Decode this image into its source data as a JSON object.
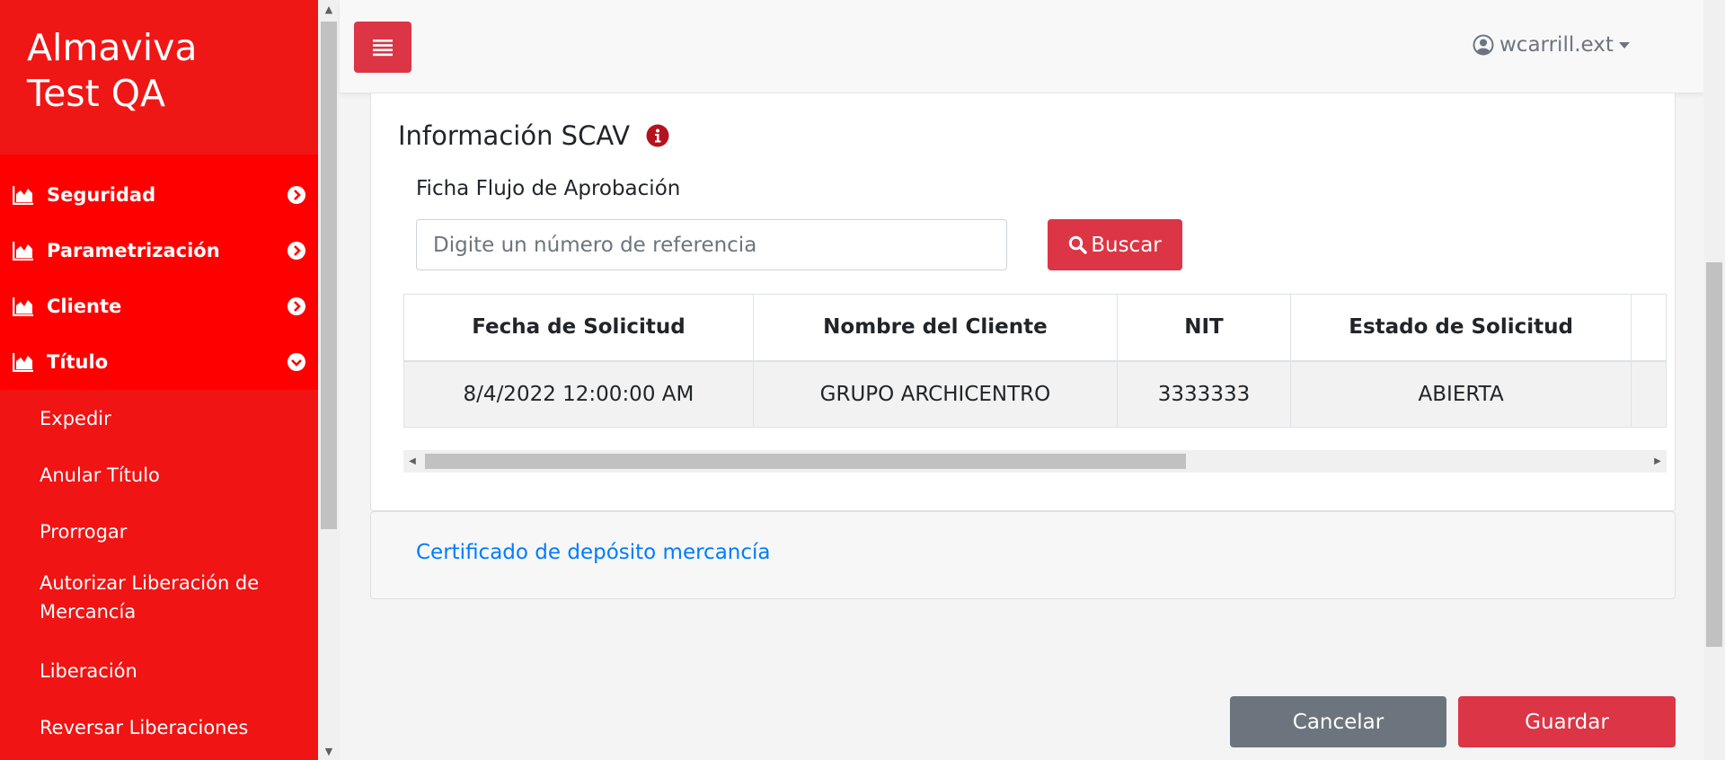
{
  "brand": {
    "line1": "Almaviva",
    "line2": "Test QA"
  },
  "sidebar": {
    "menu": [
      {
        "label": "Seguridad",
        "icon": "chart-area-icon",
        "state": "collapsed"
      },
      {
        "label": "Parametrización",
        "icon": "chart-area-icon",
        "state": "collapsed"
      },
      {
        "label": "Cliente",
        "icon": "chart-area-icon",
        "state": "collapsed"
      },
      {
        "label": "Título",
        "icon": "chart-area-icon",
        "state": "expanded"
      }
    ],
    "submenu": [
      "Expedir",
      "Anular Título",
      "Prorrogar",
      "Autorizar Liberación de Mercancía",
      "Liberación",
      "Reversar Liberaciones"
    ]
  },
  "topbar": {
    "menu_toggle_icon": "hamburger-icon",
    "username": "wcarrill.ext"
  },
  "section": {
    "title": "Información SCAV",
    "field_label": "Ficha Flujo de Aprobación",
    "search_placeholder": "Digite un número de referencia",
    "search_value": "",
    "search_button": "Buscar"
  },
  "table": {
    "headers": [
      "Fecha de Solicitud",
      "Nombre del Cliente",
      "NIT",
      "Estado de Solicitud",
      ""
    ],
    "rows": [
      [
        "8/4/2022 12:00:00 AM",
        "GRUPO ARCHICENTRO",
        "3333333",
        "ABIERTA",
        ""
      ]
    ]
  },
  "certificate": {
    "link": "Certificado de depósito mercancía"
  },
  "actions": {
    "cancel": "Cancelar",
    "save": "Guardar"
  },
  "colors": {
    "sidebar": "#f01414",
    "sidebar_menu": "#ff0000",
    "primary_red": "#dc3545",
    "secondary_gray": "#6c757d",
    "link_blue": "#007bff"
  }
}
